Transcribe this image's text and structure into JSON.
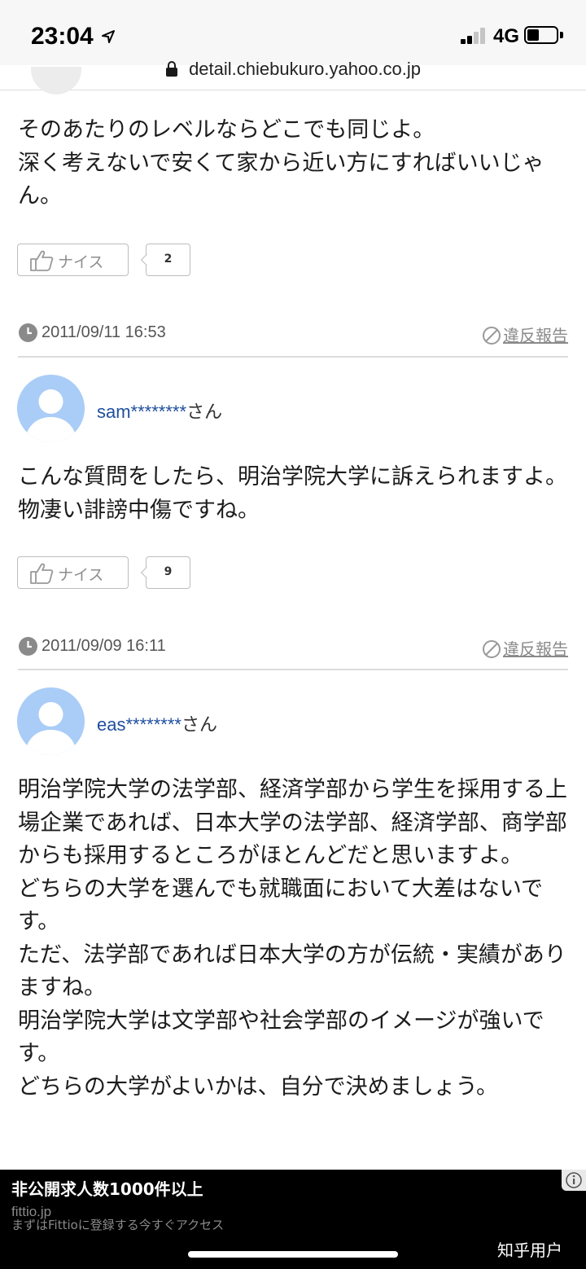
{
  "status_bar": {
    "time": "23:04",
    "network": "4G"
  },
  "browser": {
    "url": "detail.chiebukuro.yahoo.co.jp"
  },
  "answers": [
    {
      "text": "そのあたりのレベルならどこでも同じよ。\n深く考えないで安くて家から近い方にすればいいじゃん。",
      "nice_label": "ナイス",
      "nice_count": "2",
      "date": "2011/09/11 16:53",
      "report_label": "違反報告"
    },
    {
      "user": "sam********",
      "honorific": "さん",
      "text": "こんな質問をしたら、明治学院大学に訴えられますよ。物凄い誹謗中傷ですね。",
      "nice_label": "ナイス",
      "nice_count": "9",
      "date": "2011/09/09 16:11",
      "report_label": "違反報告"
    },
    {
      "user": "eas********",
      "honorific": "さん",
      "text": "明治学院大学の法学部、経済学部から学生を採用する上場企業であれば、日本大学の法学部、経済学部、商学部からも採用するところがほとんどだと思いますよ。\nどちらの大学を選んでも就職面において大差はないです。\nただ、法学部であれば日本大学の方が伝統・実績がありますね。\n明治学院大学は文学部や社会学部のイメージが強いです。\nどちらの大学がよいかは、自分で決めましょう。"
    }
  ],
  "ad": {
    "title": "非公開求人数1000件以上",
    "domain": "fittio.jp",
    "description": "まずはFittioに登録する今すぐアクセス"
  },
  "watermark": "知乎用户",
  "colors": {
    "username": "#1f4e9e",
    "avatar_bg": "#a9cdf7",
    "ad_bg": "#000000"
  }
}
